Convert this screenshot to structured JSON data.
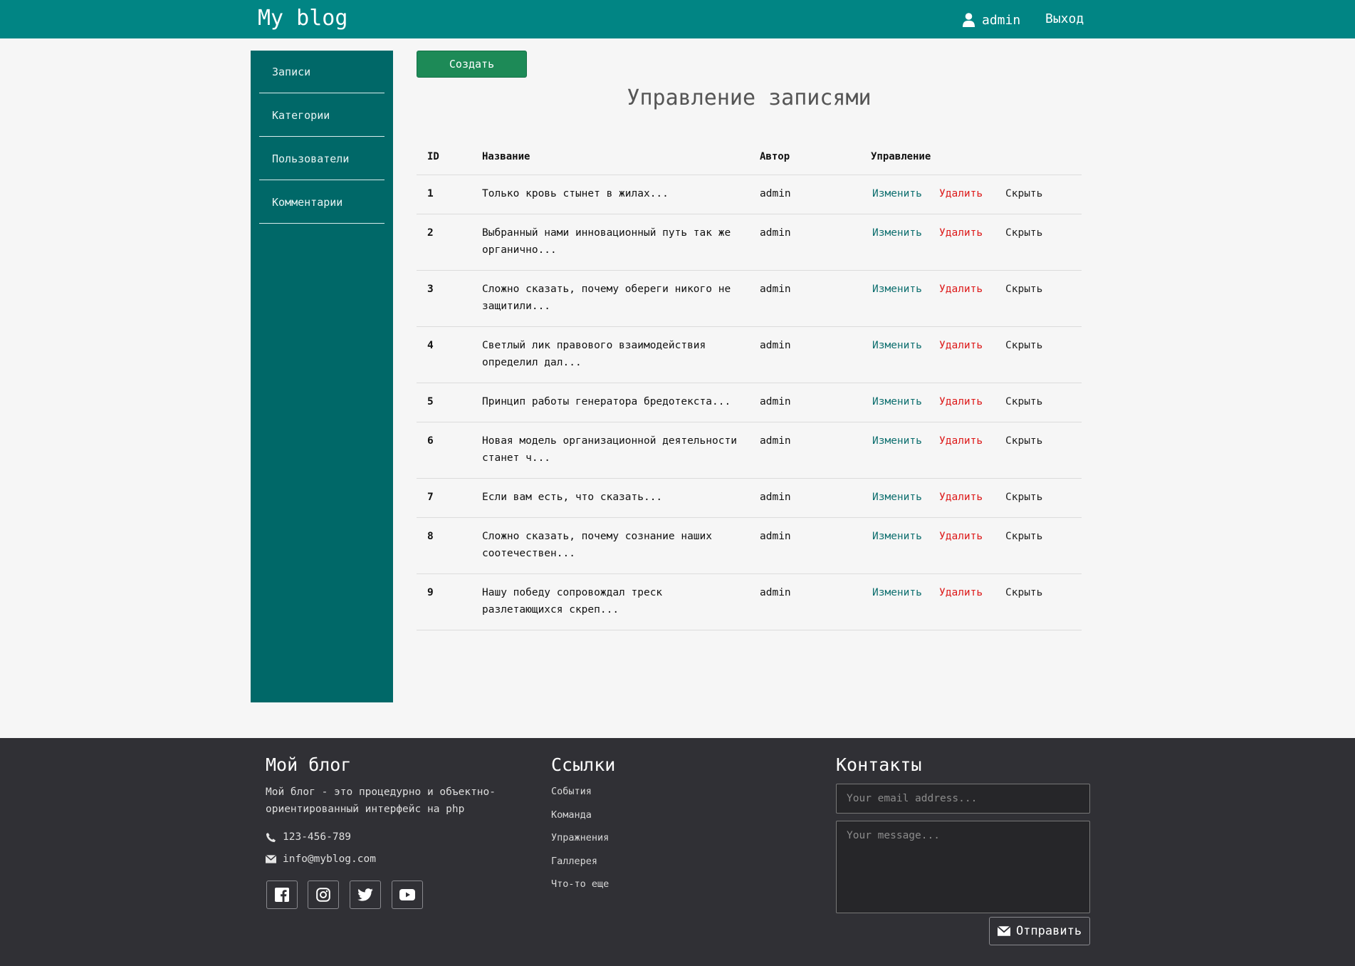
{
  "header": {
    "brand": "My blog",
    "user": "admin",
    "logout": "Выход",
    "user_icon": "user-icon"
  },
  "sidebar": {
    "items": [
      {
        "label": "Записи"
      },
      {
        "label": "Категории"
      },
      {
        "label": "Пользователи"
      },
      {
        "label": "Комментарии"
      }
    ]
  },
  "main": {
    "create_label": "Создать",
    "title": "Управление записями",
    "columns": [
      "ID",
      "Название",
      "Автор",
      "Управление"
    ],
    "actions": {
      "edit": "Изменить",
      "delete": "Удалить",
      "hide": "Скрыть"
    },
    "rows": [
      {
        "id": "1",
        "title": "Только кровь стынет в жилах...",
        "author": "admin"
      },
      {
        "id": "2",
        "title": "Выбранный нами инновационный путь так же органично...",
        "author": "admin"
      },
      {
        "id": "3",
        "title": "Сложно сказать, почему обереги никого не защитили...",
        "author": "admin"
      },
      {
        "id": "4",
        "title": "Светлый лик правового взаимодействия определил дал...",
        "author": "admin"
      },
      {
        "id": "5",
        "title": "Принцип работы генератора бредотекста...",
        "author": "admin"
      },
      {
        "id": "6",
        "title": "Новая модель организационной деятельности станет ч...",
        "author": "admin"
      },
      {
        "id": "7",
        "title": "Если вам есть, что сказать...",
        "author": "admin"
      },
      {
        "id": "8",
        "title": "Сложно сказать, почему сознание наших соотечествен...",
        "author": "admin"
      },
      {
        "id": "9",
        "title": "Нашу победу сопровождал треск разлетающихся скреп...",
        "author": "admin"
      }
    ]
  },
  "footer": {
    "about": {
      "title": "Мой блог",
      "text": "Мой блог - это процедурно и объектно-ориентированный интерфейс на php",
      "phone": "123-456-789",
      "email": "info@myblog.com"
    },
    "links": {
      "title": "Ссылки",
      "items": [
        "События",
        "Команда",
        "Упражнения",
        "Галлерея",
        "Что-то еще"
      ]
    },
    "contacts": {
      "title": "Контакты",
      "email_placeholder": "Your email address...",
      "message_placeholder": "Your message...",
      "send_label": "Отправить"
    },
    "social_icons": [
      "facebook-icon",
      "instagram-icon",
      "twitter-icon",
      "youtube-icon"
    ]
  },
  "colors": {
    "header": "#018584",
    "sidebar": "#006868",
    "create_button": "#1d8a57",
    "edit_link": "#0e6f6f",
    "delete_link": "#dd1a1a",
    "footer": "#303035"
  }
}
